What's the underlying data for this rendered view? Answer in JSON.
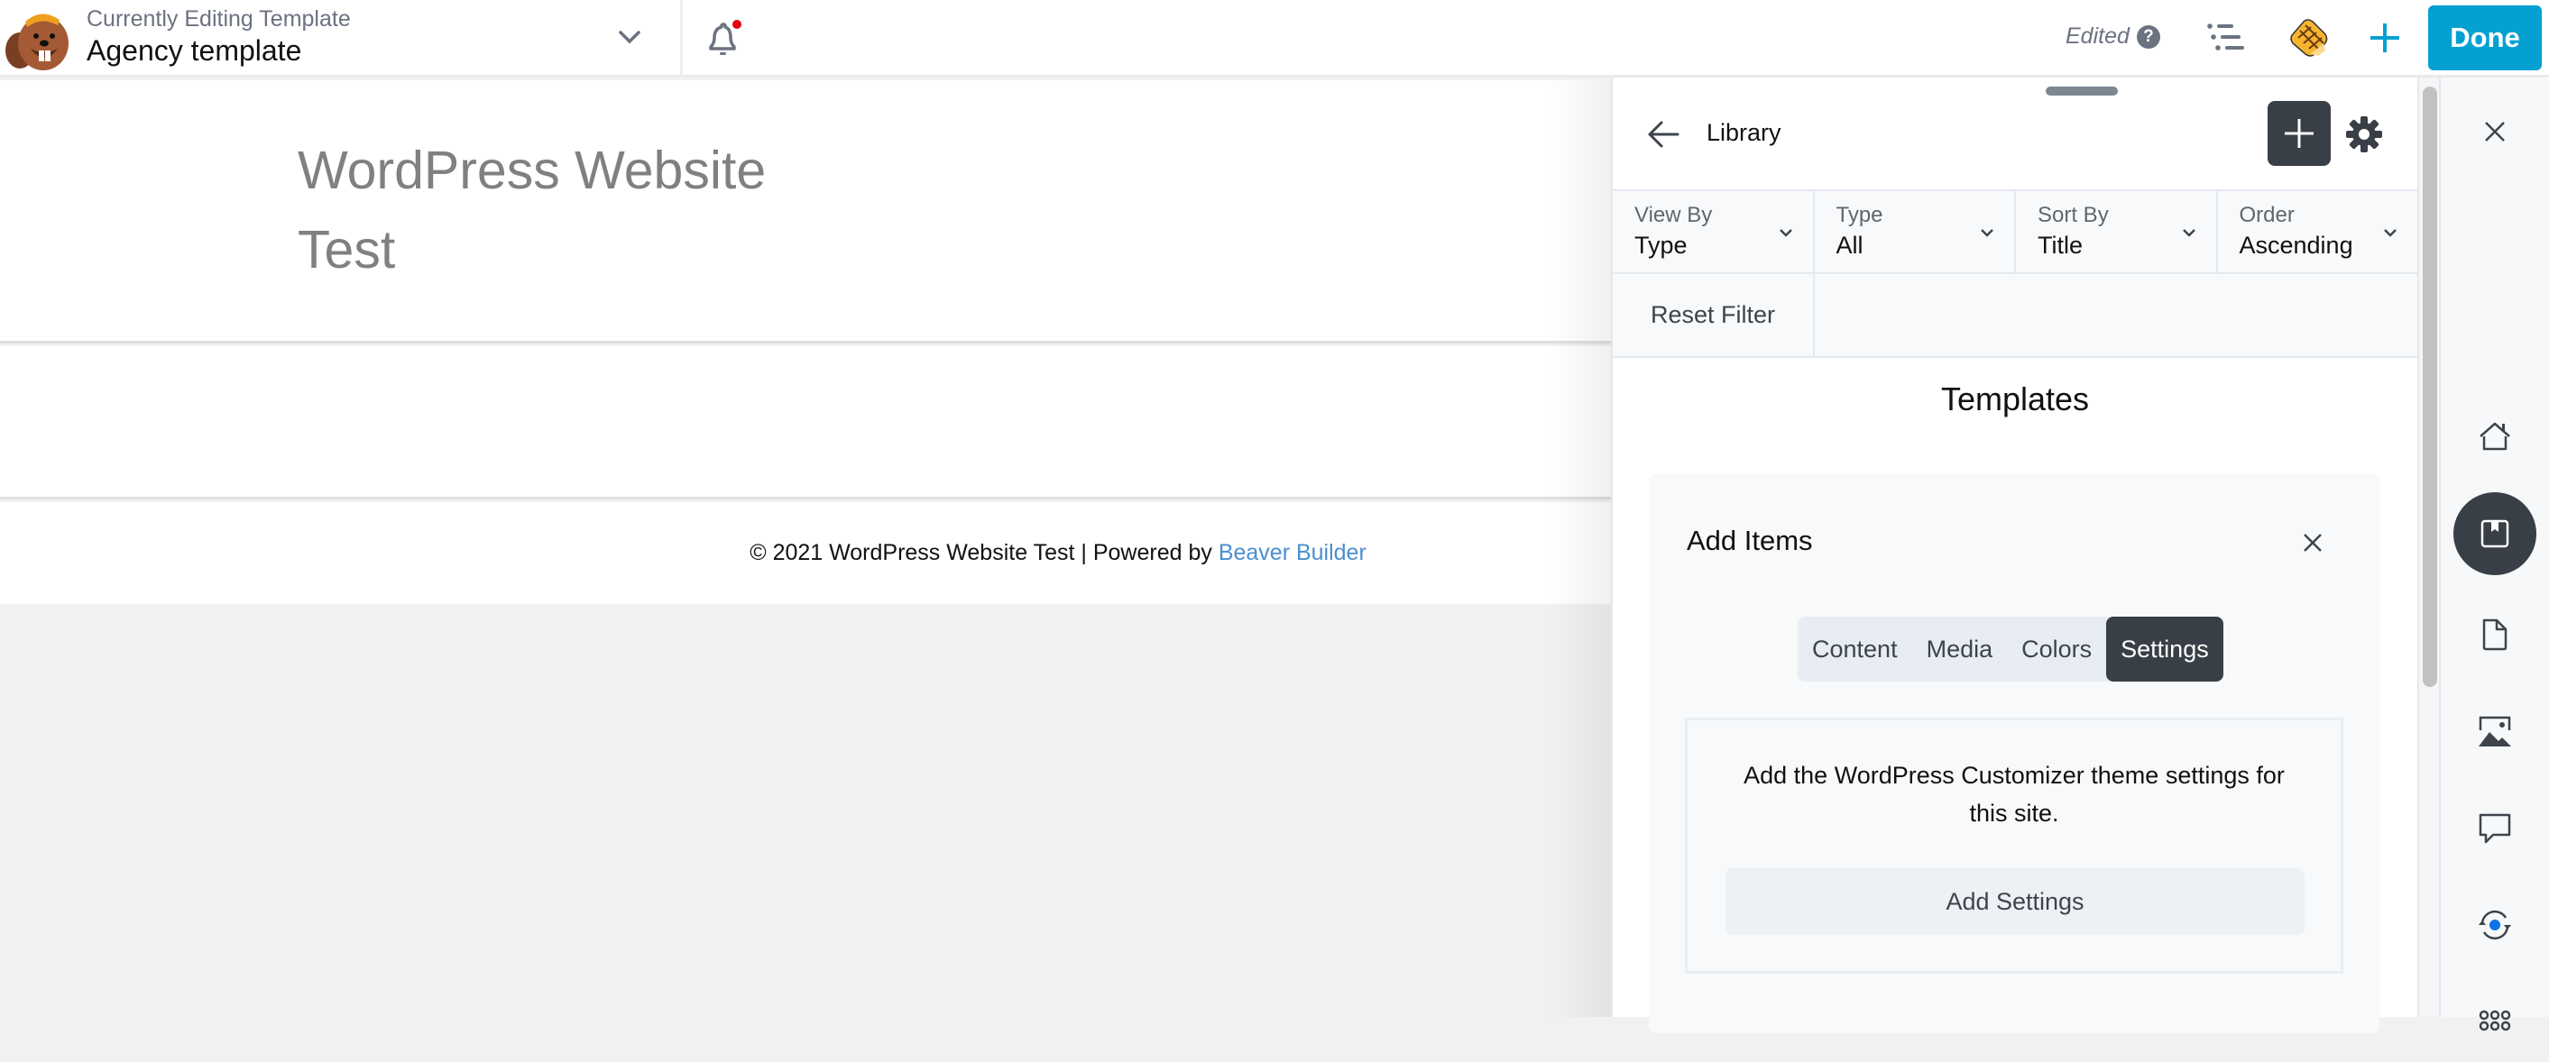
{
  "topbar": {
    "subtitle": "Currently Editing Template",
    "title": "Agency template",
    "status": "Edited",
    "help_glyph": "?",
    "done_label": "Done",
    "notification_dot_color": "#e5000b",
    "accent_color": "#05a0d2",
    "icons": [
      "beaver-logo-icon",
      "chevron-down-icon",
      "bell-icon",
      "help-icon",
      "outline-icon",
      "pencil-icon",
      "plus-icon"
    ]
  },
  "canvas": {
    "site_title": "WordPress Website Test",
    "footer_text": "© 2021 WordPress Website Test | Powered by ",
    "footer_link": "Beaver Builder"
  },
  "panel": {
    "back_icon": "arrow-left-icon",
    "title": "Library",
    "filters": [
      {
        "label": "View By",
        "value": "Type"
      },
      {
        "label": "Type",
        "value": "All"
      },
      {
        "label": "Sort By",
        "value": "Title"
      },
      {
        "label": "Order",
        "value": "Ascending"
      }
    ],
    "reset_label": "Reset Filter",
    "section_title": "Templates",
    "card": {
      "title": "Add Items",
      "tabs": [
        {
          "label": "Content",
          "active": false
        },
        {
          "label": "Media",
          "active": false
        },
        {
          "label": "Colors",
          "active": false
        },
        {
          "label": "Settings",
          "active": true
        }
      ],
      "info_text": "Add the WordPress Customizer theme settings for this site.",
      "button_label": "Add Settings"
    }
  },
  "rail": {
    "items": [
      {
        "name": "close-icon",
        "active": false
      },
      {
        "name": "home-icon",
        "active": false
      },
      {
        "name": "library-icon",
        "active": true
      },
      {
        "name": "page-icon",
        "active": false
      },
      {
        "name": "media-icon",
        "active": false
      },
      {
        "name": "comment-icon",
        "active": false
      },
      {
        "name": "revisions-icon",
        "active": false
      },
      {
        "name": "apps-icon",
        "active": false
      }
    ]
  }
}
